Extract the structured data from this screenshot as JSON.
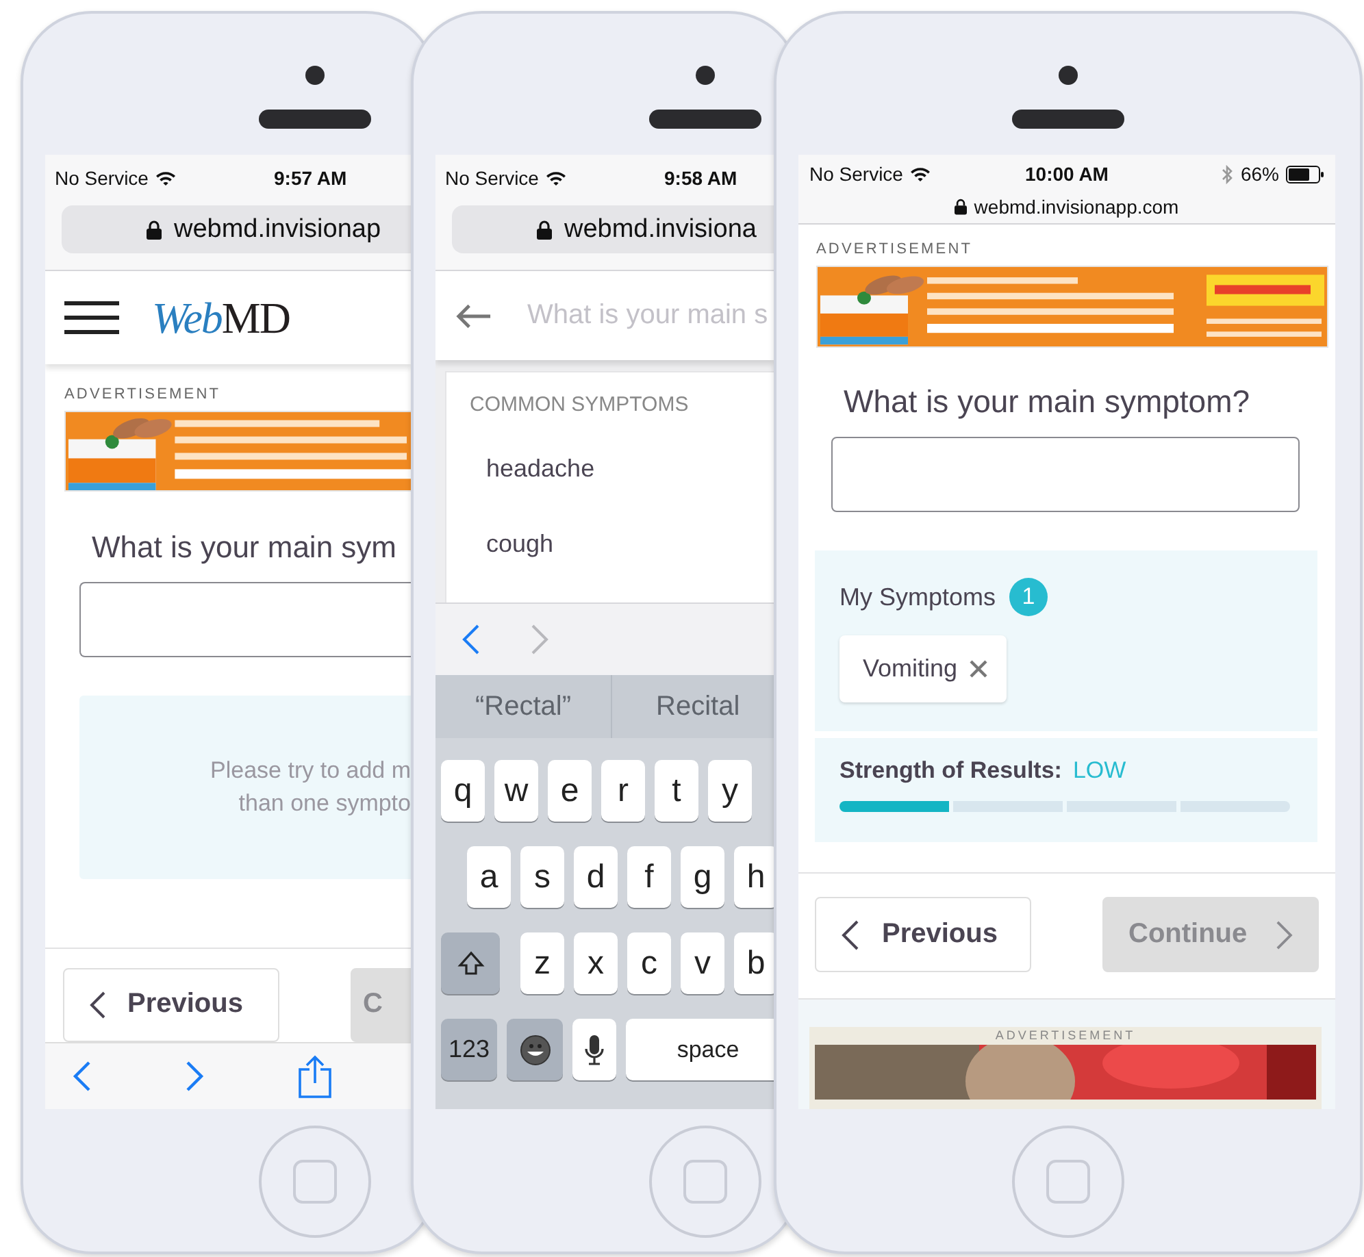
{
  "phones": [
    {
      "kind": "intro",
      "status": {
        "carrier": "No Service",
        "time": "9:57 AM"
      },
      "url": "webmd.invisionap",
      "logo": {
        "accent": "Web",
        "rest": "MD"
      },
      "ad_label": "ADVERTISEMENT",
      "question": "What is your main sym",
      "hint_lines": [
        "Please try to add m",
        "than one sympto"
      ],
      "buttons": [
        {
          "label": "Previous",
          "kind": "back",
          "disabled": false
        },
        {
          "label": "C",
          "kind": "next",
          "disabled": true
        }
      ]
    },
    {
      "kind": "search",
      "status": {
        "carrier": "No Service",
        "time": "9:58 AM"
      },
      "url": "webmd.invisiona",
      "search": {
        "placeholder": "What is your main s"
      },
      "suggest_heading": "COMMON SYMPTOMS",
      "suggestions": [
        "headache",
        "cough"
      ],
      "form_nav": [
        {
          "kind": "prev",
          "disabled": false
        },
        {
          "kind": "next",
          "disabled": true
        }
      ],
      "autocorrect": [
        "“Rectal”",
        "Recital"
      ],
      "keys": [
        [
          {
            "kind": "letter",
            "label": "q"
          },
          {
            "kind": "letter",
            "label": "w"
          },
          {
            "kind": "letter",
            "label": "e"
          },
          {
            "kind": "letter",
            "label": "r"
          },
          {
            "kind": "letter",
            "label": "t"
          },
          {
            "kind": "letter",
            "label": "y"
          }
        ],
        [
          {
            "kind": "letter",
            "label": "a"
          },
          {
            "kind": "letter",
            "label": "s"
          },
          {
            "kind": "letter",
            "label": "d"
          },
          {
            "kind": "letter",
            "label": "f"
          },
          {
            "kind": "letter",
            "label": "g"
          },
          {
            "kind": "letter",
            "label": "h"
          }
        ],
        [
          {
            "kind": "shift"
          },
          {
            "kind": "letter",
            "label": "z"
          },
          {
            "kind": "letter",
            "label": "x"
          },
          {
            "kind": "letter",
            "label": "c"
          },
          {
            "kind": "letter",
            "label": "v"
          },
          {
            "kind": "letter",
            "label": "b"
          }
        ],
        [
          {
            "kind": "mode",
            "label": "123"
          },
          {
            "kind": "emoji"
          },
          {
            "kind": "mic"
          },
          {
            "kind": "space",
            "label": "space"
          }
        ]
      ]
    },
    {
      "kind": "summary",
      "status": {
        "carrier": "No Service",
        "time": "10:00 AM",
        "battery": "66%"
      },
      "url": "webmd.invisionapp.com",
      "ad_label": "ADVERTISEMENT",
      "question": "What is your main symptom?",
      "my_symptoms": {
        "title": "My Symptoms",
        "count": "1",
        "items": [
          "Vomiting"
        ]
      },
      "strength": {
        "label": "Strength of Results:",
        "value": "LOW",
        "level": 0.25
      },
      "buttons": [
        {
          "label": "Previous",
          "kind": "back",
          "disabled": false
        },
        {
          "label": "Continue",
          "kind": "next",
          "disabled": true
        }
      ],
      "bottom_ad_label": "ADVERTISEMENT"
    }
  ]
}
